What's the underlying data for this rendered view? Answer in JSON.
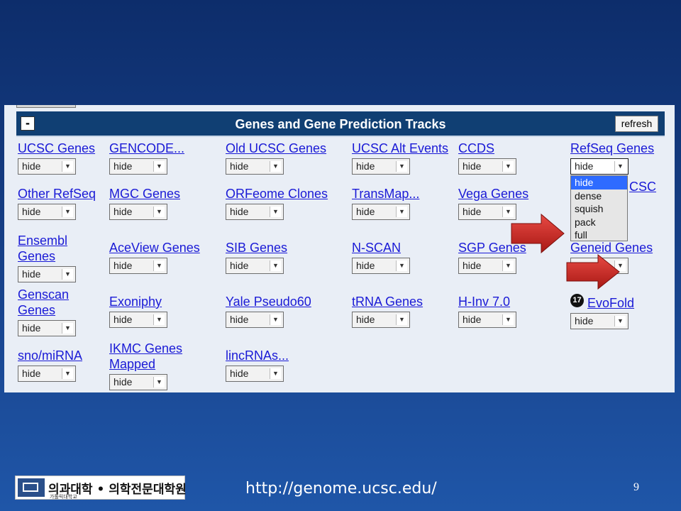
{
  "panel": {
    "title": "Genes and Gene Prediction Tracks",
    "collapse_label": "-",
    "refresh_label": "refresh"
  },
  "tracks": [
    {
      "name": "UCSC Genes",
      "value": "hide"
    },
    {
      "name": "GENCODE...",
      "value": "hide"
    },
    {
      "name": "Old UCSC Genes",
      "value": "hide"
    },
    {
      "name": "UCSC Alt Events",
      "value": "hide"
    },
    {
      "name": "CCDS",
      "value": "hide"
    },
    {
      "name": "RefSeq Genes",
      "value": "hide"
    },
    {
      "name": "Other RefSeq",
      "value": "hide"
    },
    {
      "name": "MGC Genes",
      "value": "hide"
    },
    {
      "name": "ORFeome Clones",
      "value": "hide"
    },
    {
      "name": "TransMap...",
      "value": "hide"
    },
    {
      "name": "Vega Genes",
      "value": "hide"
    },
    {
      "name": "CSC",
      "value": ""
    },
    {
      "name": "Ensembl Genes",
      "value": "hide"
    },
    {
      "name": "AceView Genes",
      "value": "hide"
    },
    {
      "name": "SIB Genes",
      "value": "hide"
    },
    {
      "name": "N-SCAN",
      "value": "hide"
    },
    {
      "name": "SGP Genes",
      "value": "hide"
    },
    {
      "name": "Geneid Genes",
      "value": ""
    },
    {
      "name": "Genscan Genes",
      "value": "hide"
    },
    {
      "name": "Exoniphy",
      "value": "hide"
    },
    {
      "name": "Yale Pseudo60",
      "value": "hide"
    },
    {
      "name": "tRNA Genes",
      "value": "hide"
    },
    {
      "name": "H-Inv 7.0",
      "value": "hide"
    },
    {
      "name": "EvoFold",
      "value": "hide"
    },
    {
      "name": "sno/miRNA",
      "value": "hide"
    },
    {
      "name": "IKMC Genes Mapped",
      "value": "hide"
    },
    {
      "name": "lincRNAs...",
      "value": "hide"
    }
  ],
  "dropdown_options": [
    "hide",
    "dense",
    "squish",
    "pack",
    "full"
  ],
  "step_badge": "17",
  "footer": {
    "logo_text": "의과대학 • 의학전문대학원",
    "logo_subtext": "가톨릭대학교",
    "url": "http://genome.ucsc.edu/",
    "page_number": "9"
  },
  "colors": {
    "panel_header": "#103f73",
    "link": "#1a1ad6",
    "highlight": "#2e6bff",
    "arrow": "#d42a26",
    "slide_bg": "#163e85"
  },
  "icons": [
    "collapse-icon",
    "chevron-down-icon",
    "red-arrow-icon",
    "step-badge-icon",
    "university-logo-icon"
  ]
}
